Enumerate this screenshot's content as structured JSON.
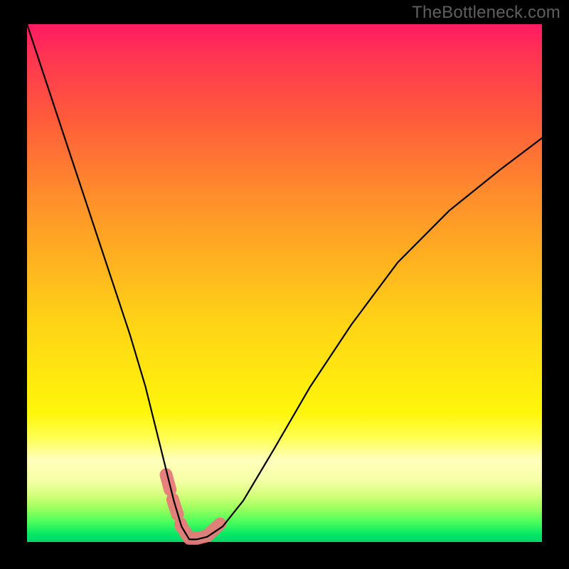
{
  "watermark": "TheBottleneck.com",
  "chart_data": {
    "type": "line",
    "title": "",
    "xlabel": "",
    "ylabel": "",
    "xlim": [
      0,
      100
    ],
    "ylim": [
      0,
      100
    ],
    "grid": false,
    "legend": false,
    "series": [
      {
        "name": "bottleneck-curve",
        "x": [
          0,
          4,
          8,
          12,
          16,
          20,
          23,
          25,
          27,
          28.5,
          30,
          31.5,
          33,
          35,
          38,
          42,
          48,
          55,
          63,
          72,
          82,
          92,
          100
        ],
        "y": [
          100,
          88,
          76,
          64,
          52,
          40,
          30,
          22,
          14,
          8,
          3,
          0.5,
          0.5,
          1.0,
          3,
          8,
          18,
          30,
          42,
          54,
          64,
          72,
          78
        ]
      }
    ],
    "annotations": [
      {
        "name": "highlight-segment",
        "type": "polyline",
        "style": "thick-salmon",
        "x": [
          27.0,
          28.5,
          30.0,
          31.5,
          33.0,
          35.0,
          37.5
        ],
        "y": [
          13.0,
          7.5,
          3.0,
          0.7,
          0.7,
          1.2,
          3.5
        ]
      }
    ],
    "colors": {
      "curve": "#000000",
      "highlight": "#e77a7a",
      "gradient_top": "#ff1a63",
      "gradient_mid": "#ffef10",
      "gradient_bottom": "#00d768",
      "frame": "#000000"
    }
  }
}
